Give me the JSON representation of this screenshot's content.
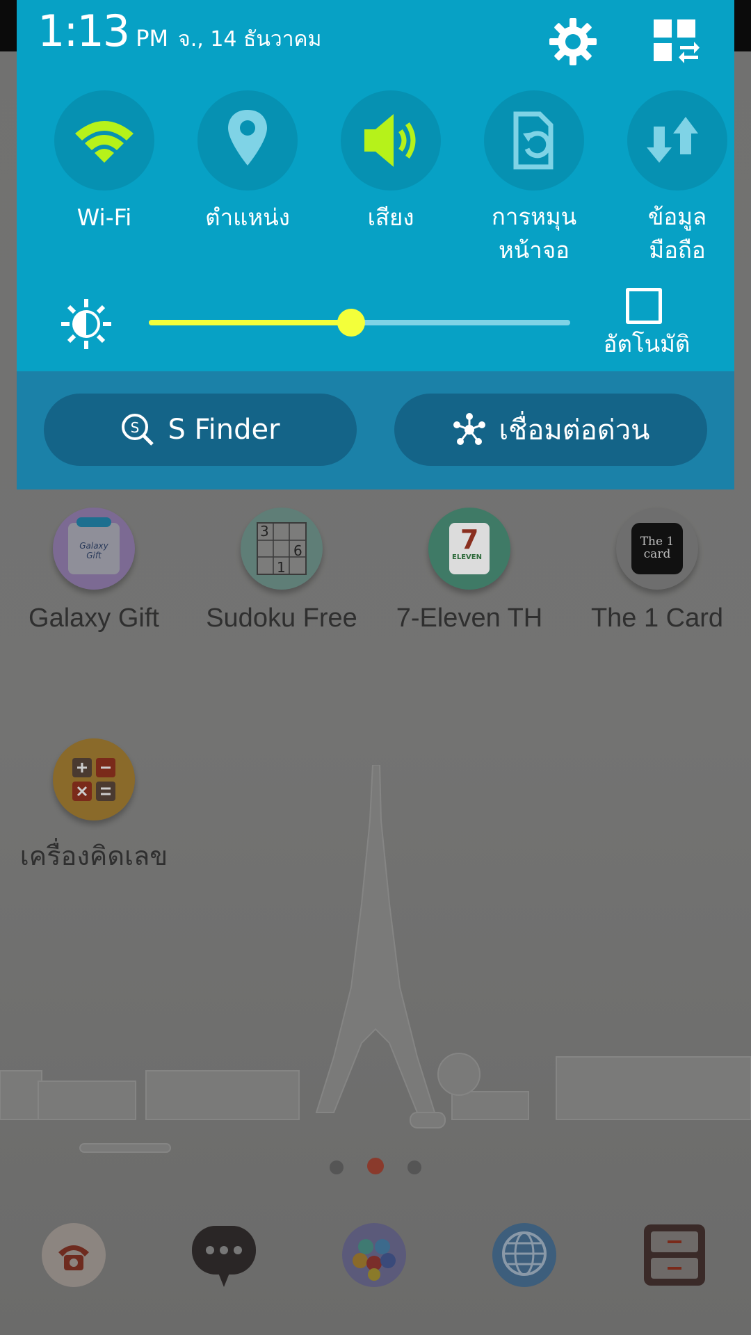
{
  "quick_panel": {
    "time": "1:13",
    "ampm": "PM",
    "date": "จ., 14 ธันวาคม",
    "settings_icon": "gear-icon",
    "edit_icon": "grid-edit-icon",
    "toggles": [
      {
        "label": "Wi-Fi",
        "icon": "wifi-icon",
        "active": true
      },
      {
        "label": "ตำแหน่ง",
        "icon": "location-pin-icon",
        "active": false
      },
      {
        "label": "เสียง",
        "icon": "speaker-icon",
        "active": true
      },
      {
        "label": "การหมุน\nหน้าจอ",
        "icon": "screen-rotation-icon",
        "active": false
      },
      {
        "label": "ข้อมูล\nมือถือ",
        "icon": "mobile-data-icon",
        "active": false
      }
    ],
    "brightness": {
      "level": 0.48,
      "auto_label": "อัตโนมัติ",
      "auto_checked": false
    },
    "s_finder_label": "S Finder",
    "quick_connect_label": "เชื่อมต่อด่วน",
    "accent_color": "#07a1c5",
    "active_icon_color": "#b6f21a",
    "slider_color": "#f3ff3a"
  },
  "home": {
    "apps": [
      {
        "label": "Galaxy Gift",
        "icon": "gift-icon"
      },
      {
        "label": "Sudoku Free",
        "icon": "sudoku-icon"
      },
      {
        "label": "7-Eleven TH",
        "icon": "seven-eleven-icon"
      },
      {
        "label": "The 1 Card",
        "icon": "the1card-icon"
      },
      {
        "label": "เครื่องคิดเลข",
        "icon": "calculator-icon"
      }
    ],
    "app_icon_texts": {
      "gift_text": "Galaxy Gift",
      "sudoku_top_left": "3",
      "sudoku_mid_right": "6",
      "sudoku_bottom_mid": "1",
      "seven_text": "7",
      "eleven_text": "ELEVEN",
      "card_text": "The 1 card"
    },
    "pages": {
      "count": 3,
      "current": 2
    },
    "dock": [
      "phone-icon",
      "messages-icon",
      "apps-icon",
      "internet-icon",
      "contacts-icon"
    ]
  }
}
